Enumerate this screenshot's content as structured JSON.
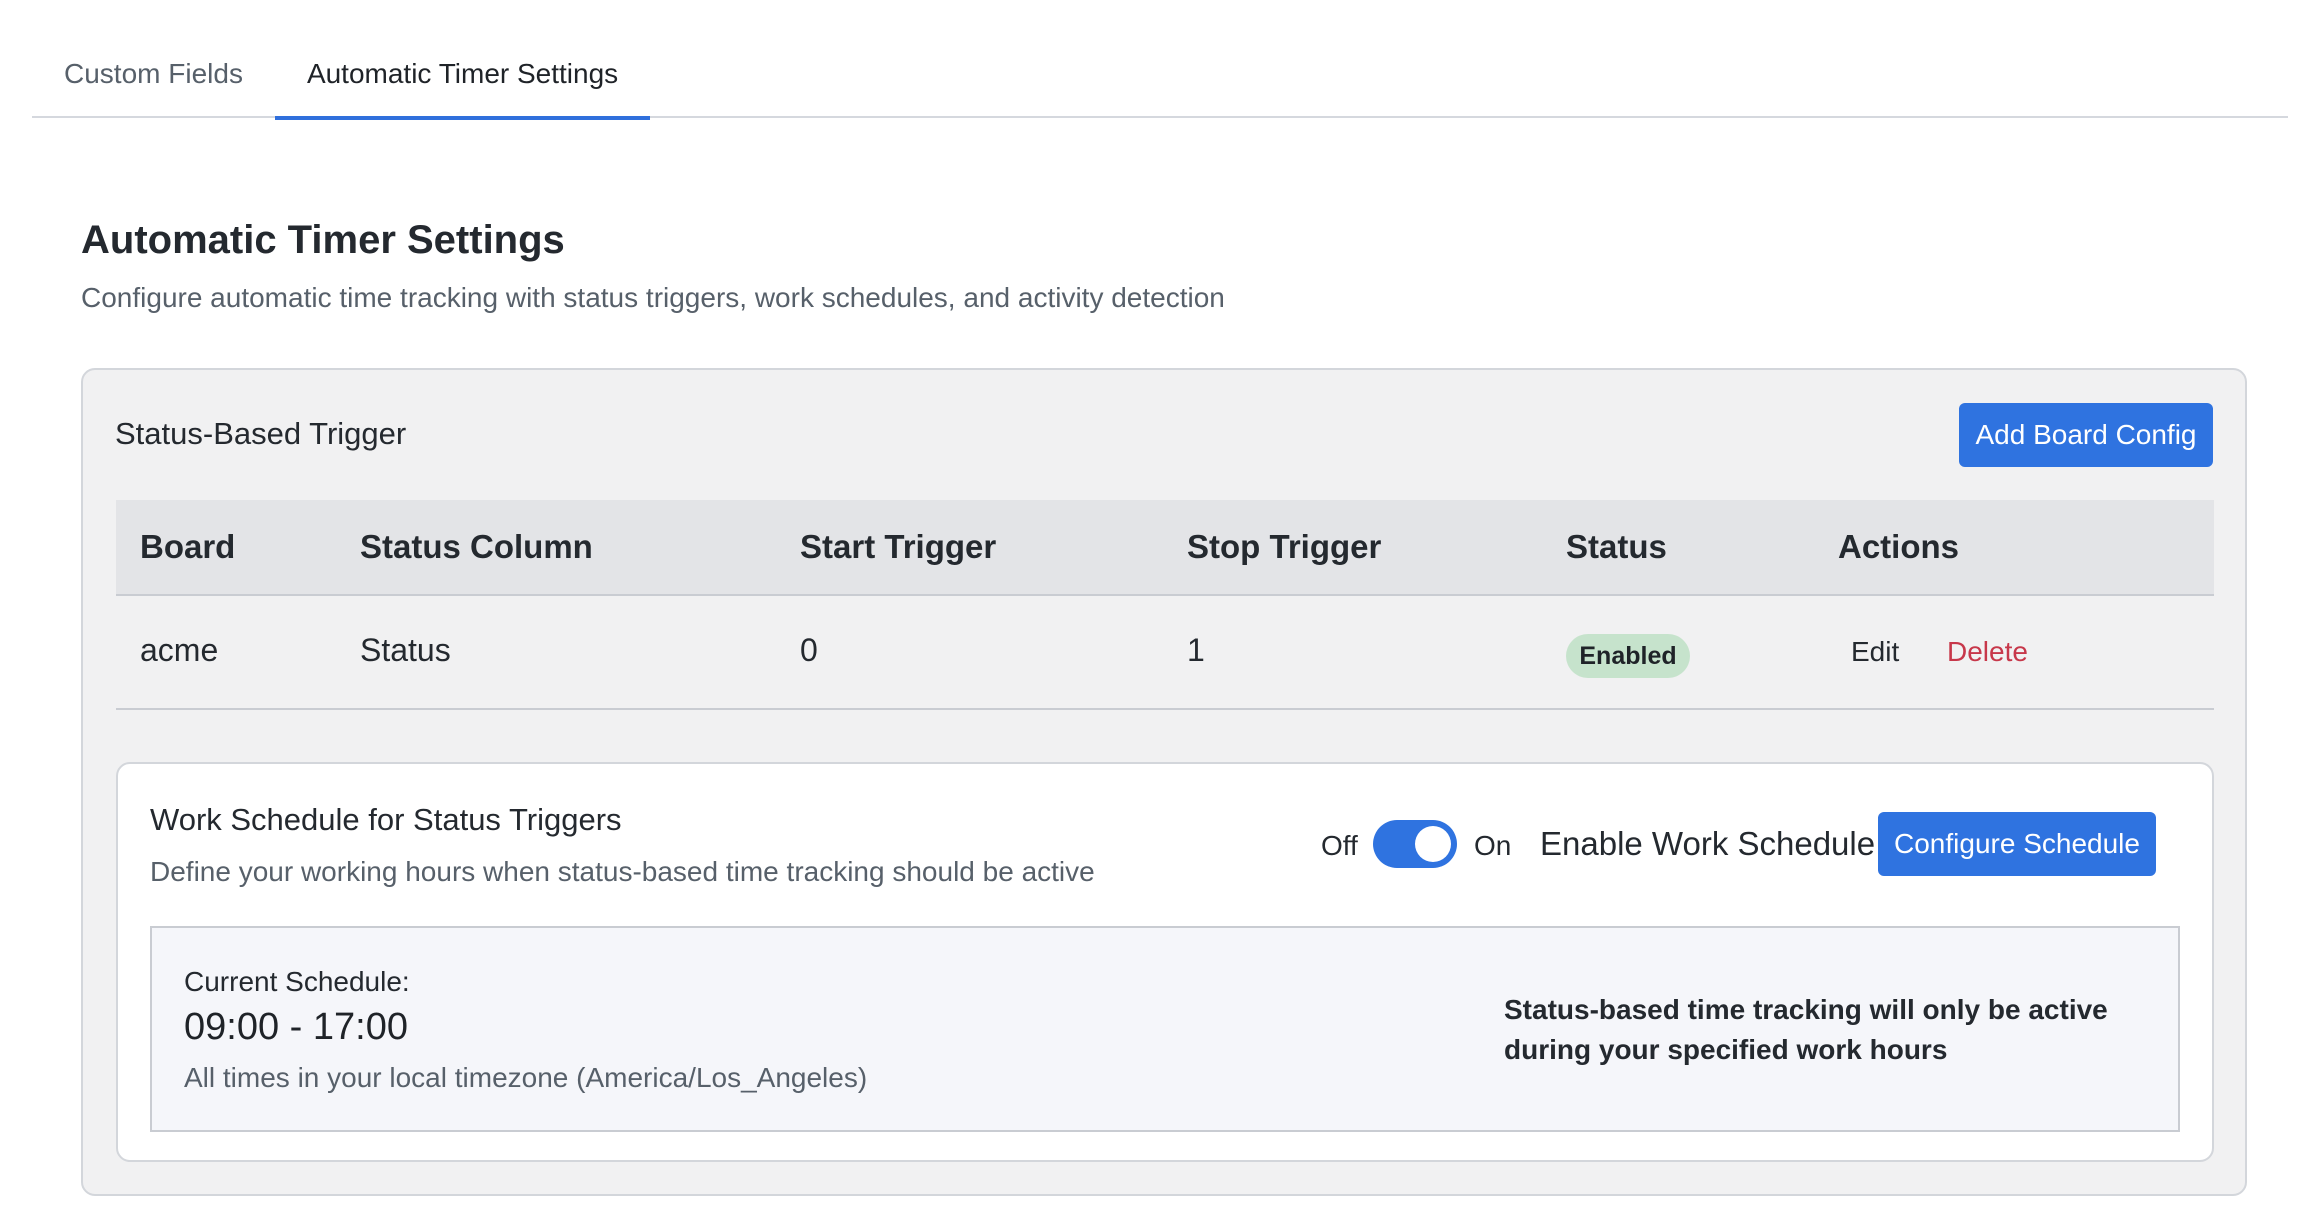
{
  "tabs": [
    {
      "label": "Custom Fields",
      "active": false
    },
    {
      "label": "Automatic Timer Settings",
      "active": true
    }
  ],
  "page": {
    "title": "Automatic Timer Settings",
    "description": "Configure automatic time tracking with status triggers, work schedules, and activity detection"
  },
  "status_trigger": {
    "title": "Status-Based Trigger",
    "add_button_label": "Add Board Config",
    "table": {
      "headers": {
        "board": "Board",
        "status_column": "Status Column",
        "start_trigger": "Start Trigger",
        "stop_trigger": "Stop Trigger",
        "status": "Status",
        "actions": "Actions"
      },
      "rows": [
        {
          "board": "acme",
          "status_column": "Status",
          "start_trigger": "0",
          "stop_trigger": "1",
          "status": "Enabled",
          "edit_label": "Edit",
          "delete_label": "Delete"
        }
      ]
    }
  },
  "work_schedule": {
    "title": "Work Schedule for Status Triggers",
    "description": "Define your working hours when status-based time tracking should be active",
    "toggle": {
      "off_label": "Off",
      "on_label": "On",
      "label": "Enable Work Schedule",
      "enabled": true
    },
    "configure_button_label": "Configure Schedule",
    "current": {
      "label": "Current Schedule:",
      "time": "09:00 - 17:00",
      "timezone_note": "All times in your local timezone (America/Los_Angeles)",
      "info": "Status-based time tracking will only be active during your specified work hours"
    }
  },
  "colors": {
    "accent": "#2f73e0",
    "enabled_badge_bg": "#c6e3cc",
    "delete_text": "#c7374a",
    "card_bg": "#f1f1f2"
  }
}
